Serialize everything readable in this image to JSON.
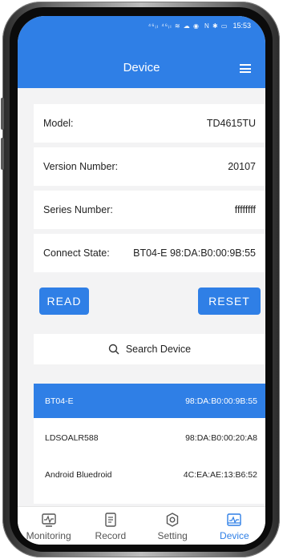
{
  "status": {
    "time": "15:53",
    "signal_text": "⁴⁶ᵢₗ ⁴⁶ᵢₗ ≋ ☁ ◉",
    "right_icons": "N ✱ ▭"
  },
  "header": {
    "title": "Device"
  },
  "info": {
    "model_label": "Model:",
    "model_value": "TD4615TU",
    "version_label": "Version Number:",
    "version_value": "20107",
    "series_label": "Series Number:",
    "series_value": "ffffffff",
    "connect_label": "Connect State:",
    "connect_value": "BT04-E 98:DA:B0:00:9B:55"
  },
  "buttons": {
    "read": "READ",
    "reset": "RESET"
  },
  "search": {
    "label": "Search Device"
  },
  "devices": [
    {
      "name": "BT04-E",
      "mac": "98:DA:B0:00:9B:55"
    },
    {
      "name": "LDSOALR588",
      "mac": "98:DA:B0:00:20:A8"
    },
    {
      "name": "Android Bluedroid",
      "mac": "4C:EA:AE:13:B6:52"
    }
  ],
  "tabs": [
    {
      "label": "Monitoring",
      "icon": "monitor-icon"
    },
    {
      "label": "Record",
      "icon": "record-icon"
    },
    {
      "label": "Setting",
      "icon": "gear-icon"
    },
    {
      "label": "Device",
      "icon": "device-icon"
    }
  ],
  "colors": {
    "accent": "#2f7fe6",
    "background": "#f3f3f4"
  }
}
